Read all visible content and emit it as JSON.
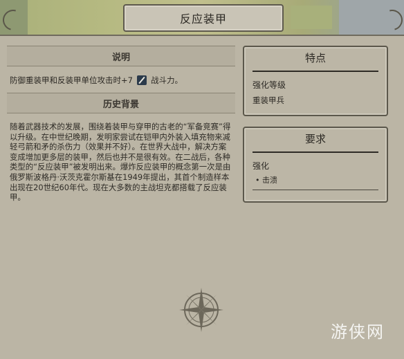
{
  "header": {
    "title": "反应装甲"
  },
  "left": {
    "desc_head": "说明",
    "desc_text_before": "防御重装甲和反装甲单位攻击时+7",
    "desc_text_after": "战斗力。",
    "hist_head": "历史背景",
    "history": "随着武器技术的发展，围绕着装甲与穿甲的古老的“军备竞赛”得以升级。在中世纪晚期，发明家尝试在铠甲内外装入填充物来减轻弓箭和矛的杀伤力（效果并不好）。在世界大战中，解决方案变成增加更多层的装甲，然后也并不是很有效。在二战后，各种类型的“反应装甲”被发明出来。爆炸反应装甲的概念第一次是由俄罗斯波格丹·沃茨克霍尔斯基在1949年提出，其首个制造样本出现在20世纪60年代。现在大多数的主战坦克都搭载了反应装甲。"
  },
  "features": {
    "title": "特点",
    "label": "强化等级",
    "value": "重装甲兵"
  },
  "requirements": {
    "title": "要求",
    "label": "强化",
    "bullet": "• 击溃"
  },
  "watermark": "游侠网",
  "icons": [
    "sword-icon",
    "compass-icon"
  ]
}
